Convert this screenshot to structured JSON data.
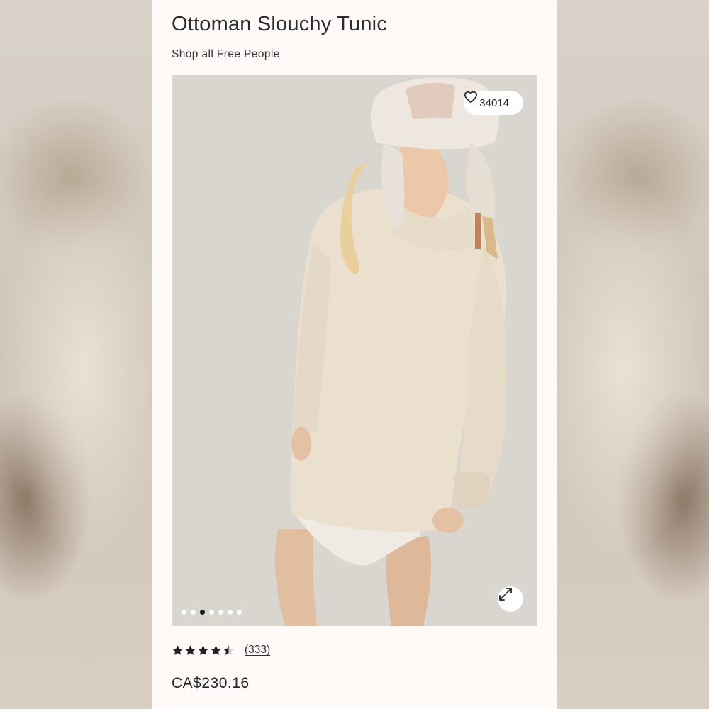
{
  "product": {
    "title": "Ottoman Slouchy Tunic",
    "shop_link": "Shop all Free People",
    "favorites_count": "34014",
    "price": "CA$230.16",
    "rating": 4.5,
    "review_count": "(333)"
  },
  "gallery": {
    "total_images": 7,
    "active_index": 2
  },
  "icons": {
    "favorite": "heart-icon",
    "expand": "expand-icon",
    "rating": "star-icon"
  },
  "colors": {
    "card_background": "#fdfaf8",
    "text": "#2b2b2b",
    "active_dot": "#1a1a1a"
  }
}
